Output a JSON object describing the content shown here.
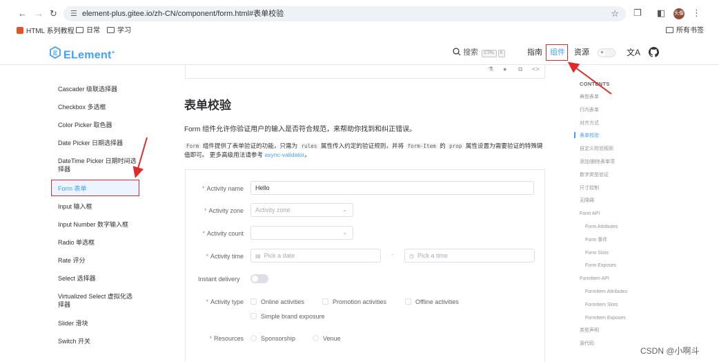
{
  "browser": {
    "url": "element-plus.gitee.io/zh-CN/component/form.html#表单校验",
    "bookmarks": [
      "HTML 系列教程",
      "日常",
      "学习"
    ],
    "all_bookmarks": "所有书签",
    "avatar_text": "头像"
  },
  "header": {
    "logo_text": "ELement",
    "logo_sup": "+",
    "search_label": "搜索",
    "search_kbd": [
      "CTRL",
      "K"
    ],
    "nav": [
      "指南",
      "组件",
      "资源"
    ],
    "translate_icon": "translate-icon",
    "github_icon": "github-icon",
    "accent": "#409eff"
  },
  "sidebar": {
    "items": [
      "Cascader 级联选择器",
      "Checkbox 多选框",
      "Color Picker 取色器",
      "Date Picker 日期选择器",
      "DateTime Picker 日期时间选择器",
      "Form 表单",
      "Input 输入框",
      "Input Number 数字输入框",
      "Radio 单选框",
      "Rate 评分",
      "Select 选择器",
      "Virtualized Select 虚拟化选择器",
      "Slider 滑块",
      "Switch 开关"
    ],
    "active_index": 5
  },
  "main": {
    "title": "表单校验",
    "intro": "Form 组件允许你验证用户的输入是否符合规范，来帮助你找到和纠正错误。",
    "intro2": {
      "p1": "组件提供了表单验证的功能，只需为",
      "p2": "属性传入约定的验证规则，并将",
      "p3": "的",
      "p4": "属性设置为需要验证的特殊键值即可。 更多高级用法请参考",
      "code_form": "Form",
      "code_rules": "rules",
      "code_formitem": "form-Item",
      "code_prop": "prop",
      "link": "async-validator",
      "end": "。"
    },
    "form": {
      "name_label": "Activity name",
      "name_value": "Hello",
      "zone_label": "Activity zone",
      "zone_placeholder": "Activity zone",
      "count_label": "Activity count",
      "time_label": "Activity time",
      "date_placeholder": "Pick a date",
      "time_placeholder": "Pick a time",
      "range_sep": "-",
      "delivery_label": "Instant delivery",
      "type_label": "Activity type",
      "types": [
        "Online activities",
        "Promotion activities",
        "Offline activities",
        "Simple brand exposure"
      ],
      "resources_label": "Resources",
      "resources": [
        "Sponsorship",
        "Venue"
      ]
    }
  },
  "toc": {
    "title": "CONTENTS",
    "items": [
      {
        "label": "典型表单",
        "indent": false
      },
      {
        "label": "行内表单",
        "indent": false
      },
      {
        "label": "对齐方式",
        "indent": false
      },
      {
        "label": "表单校验",
        "indent": false
      },
      {
        "label": "自定义校验规则",
        "indent": false
      },
      {
        "label": "添加/删除表单项",
        "indent": false
      },
      {
        "label": "数字类型验证",
        "indent": false
      },
      {
        "label": "尺寸控制",
        "indent": false
      },
      {
        "label": "无障碍",
        "indent": false
      },
      {
        "label": "Form API",
        "indent": false
      },
      {
        "label": "Form Attributes",
        "indent": true
      },
      {
        "label": "Form 事件",
        "indent": true
      },
      {
        "label": "Form Slots",
        "indent": true
      },
      {
        "label": "Form Exposes",
        "indent": true
      },
      {
        "label": "FormItem API",
        "indent": false
      },
      {
        "label": "FormItem Attributes",
        "indent": true
      },
      {
        "label": "FormItem Slots",
        "indent": true
      },
      {
        "label": "FormItem Exposes",
        "indent": true
      },
      {
        "label": "类型声明",
        "indent": false
      },
      {
        "label": "源代码",
        "indent": false
      }
    ],
    "active_index": 3
  },
  "watermark": "CSDN @小啊斗"
}
